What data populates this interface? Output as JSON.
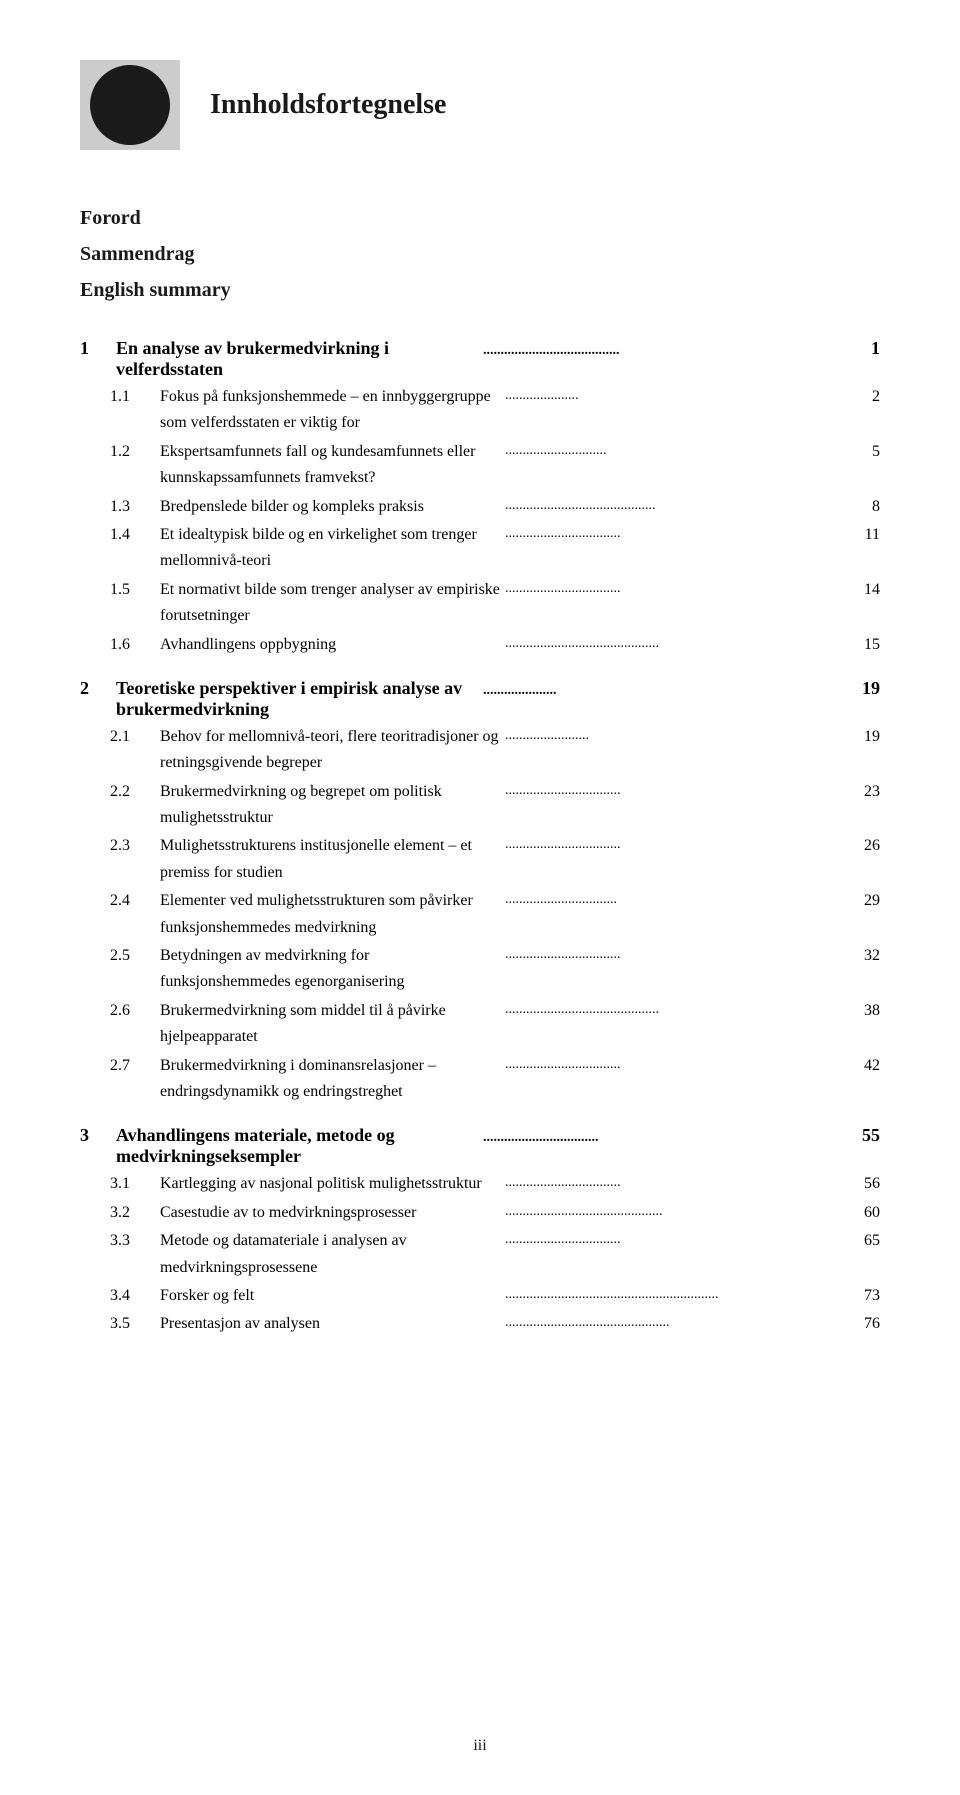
{
  "header": {
    "title": "Innholdsfortegnelse"
  },
  "front_matter": [
    {
      "label": "Forord"
    },
    {
      "label": "Sammendrag"
    },
    {
      "label": "English summary"
    }
  ],
  "chapters": [
    {
      "number": "1",
      "title": "En analyse av brukermedvirkning i velferdsstaten",
      "dots": true,
      "page": "1",
      "sections": [
        {
          "number": "1.1",
          "title": "Fokus på funksjonshemmede – en innbyggergruppe som velferdsstaten er viktig for",
          "dots": true,
          "page": "2"
        },
        {
          "number": "1.2",
          "title": "Ekspertsamfunnets fall og kundesamfunnets eller kunnskapssamfunnets framvekst?",
          "dots": true,
          "page": "5"
        },
        {
          "number": "1.3",
          "title": "Bredpenslede bilder og kompleks praksis",
          "dots": true,
          "page": "8"
        },
        {
          "number": "1.4",
          "title": "Et idealtypisk bilde og en virkelighet som trenger mellomnivå-teori",
          "dots": true,
          "page": "11"
        },
        {
          "number": "1.5",
          "title": "Et normativt bilde som trenger analyser av empiriske forutsetninger",
          "dots": true,
          "page": "14"
        },
        {
          "number": "1.6",
          "title": "Avhandlingens oppbygning",
          "dots": true,
          "page": "15"
        }
      ]
    },
    {
      "number": "2",
      "title": "Teoretiske perspektiver i empirisk analyse av brukermedvirkning",
      "dots": true,
      "page": "19",
      "sections": [
        {
          "number": "2.1",
          "title": "Behov for mellomnivå-teori, flere teoritradisjoner og retningsgivende begreper",
          "dots": true,
          "page": "19"
        },
        {
          "number": "2.2",
          "title": "Brukermedvirkning og begrepet om politisk mulighetsstruktur",
          "dots": true,
          "page": "23"
        },
        {
          "number": "2.3",
          "title": "Mulighetsstrukturens institusjonelle element – et premiss for studien",
          "dots": true,
          "page": "26"
        },
        {
          "number": "2.4",
          "title": "Elementer ved mulighetsstrukturen som påvirker funksjonshemmedes medvirkning",
          "dots": true,
          "page": "29"
        },
        {
          "number": "2.5",
          "title": "Betydningen av medvirkning for funksjonshemmedes egenorganisering",
          "dots": true,
          "page": "32"
        },
        {
          "number": "2.6",
          "title": "Brukermedvirkning som middel til å påvirke hjelpeapparatet",
          "dots": true,
          "page": "38"
        },
        {
          "number": "2.7",
          "title": "Brukermedvirkning i dominansrelasjoner – endringsdynamikk og endringstreghet",
          "dots": true,
          "page": "42"
        }
      ]
    },
    {
      "number": "3",
      "title": "Avhandlingens materiale, metode og medvirkningseksempler",
      "dots": true,
      "page": "55",
      "sections": [
        {
          "number": "3.1",
          "title": "Kartlegging av nasjonal politisk mulighetsstruktur",
          "dots": true,
          "page": "56"
        },
        {
          "number": "3.2",
          "title": "Casestudie av to medvirkningsprosesser",
          "dots": true,
          "page": "60"
        },
        {
          "number": "3.3",
          "title": "Metode og datamateriale i analysen av medvirkningsprosessene",
          "dots": true,
          "page": "65"
        },
        {
          "number": "3.4",
          "title": "Forsker og felt",
          "dots": true,
          "page": "73"
        },
        {
          "number": "3.5",
          "title": "Presentasjon av analysen",
          "dots": true,
          "page": "76"
        }
      ]
    }
  ],
  "footer": {
    "page_label": "iii"
  }
}
